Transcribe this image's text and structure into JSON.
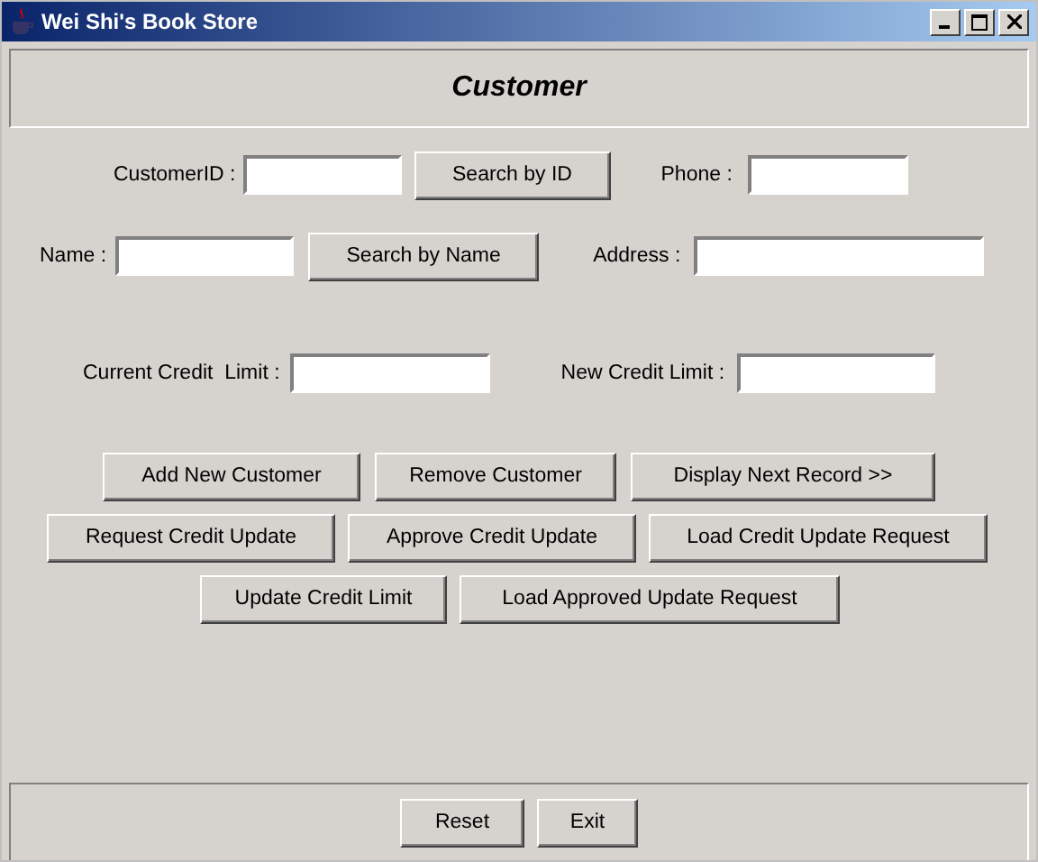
{
  "window": {
    "title": "Wei Shi's Book Store"
  },
  "header": {
    "title": "Customer"
  },
  "form_rows": [
    [
      {
        "kind": "label",
        "text": "CustomerID :"
      },
      {
        "kind": "field"
      },
      {
        "kind": "button",
        "text": "Search by ID"
      },
      {
        "kind": "label",
        "text": "Phone :"
      },
      {
        "kind": "field"
      }
    ],
    [
      {
        "kind": "label",
        "text": "Name :"
      },
      {
        "kind": "field"
      },
      {
        "kind": "button",
        "text": "Search by Name"
      },
      {
        "kind": "label",
        "text": "Address :"
      },
      {
        "kind": "field"
      }
    ],
    [
      {
        "kind": "label",
        "text": "Current Credit  Limit :"
      },
      {
        "kind": "field"
      },
      {
        "kind": "label",
        "text": "New Credit Limit :"
      },
      {
        "kind": "field"
      }
    ]
  ],
  "button_rows": [
    [
      "Add New Customer",
      "Remove Customer",
      "Display Next Record  >>"
    ],
    [
      "Request Credit Update",
      "Approve Credit Update",
      "Load Credit Update Request"
    ],
    [
      "Update Credit Limit",
      "Load Approved Update Request"
    ]
  ],
  "footer": {
    "buttons": [
      "Reset",
      "Exit"
    ]
  }
}
